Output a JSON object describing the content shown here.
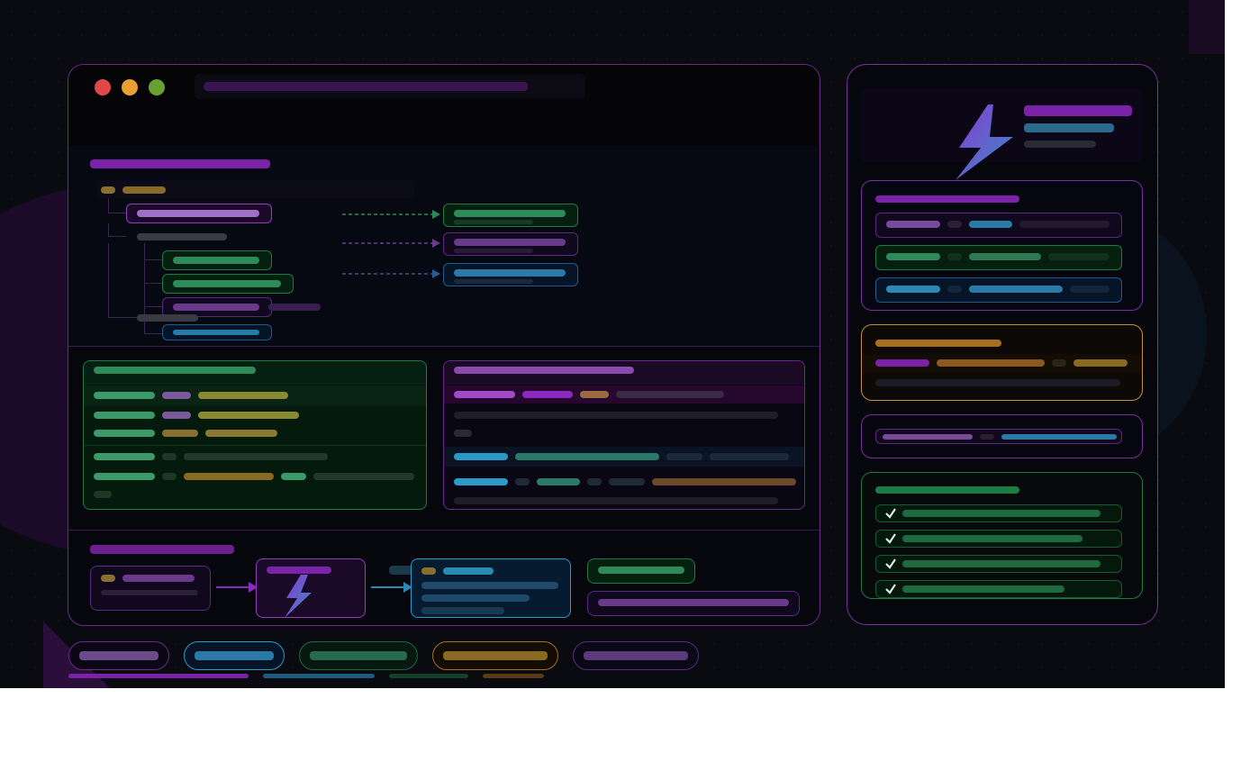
{
  "window": {
    "controls": [
      "close",
      "minimize",
      "maximize"
    ],
    "colors": {
      "close": "#e04848",
      "minimize": "#e8a030",
      "maximize": "#6aa030"
    }
  },
  "palette": {
    "purple": "#7a2aa8",
    "green": "#2f8a5a",
    "blue": "#2a7aa8",
    "amber": "#a87a2a",
    "gray": "#3a3a44",
    "border_purple": "#6b2a8a",
    "border_green": "#1f7a45",
    "border_blue": "#2a6aa0",
    "border_amber": "#c8902f"
  },
  "icons": {
    "hero": "lightning-bolt-icon",
    "pipeline": "lightning-bolt-icon",
    "checklist": "checkmark-icon",
    "flow": "arrow-right-icon"
  },
  "checklist": {
    "items_checked": [
      true,
      true,
      true,
      true
    ]
  }
}
